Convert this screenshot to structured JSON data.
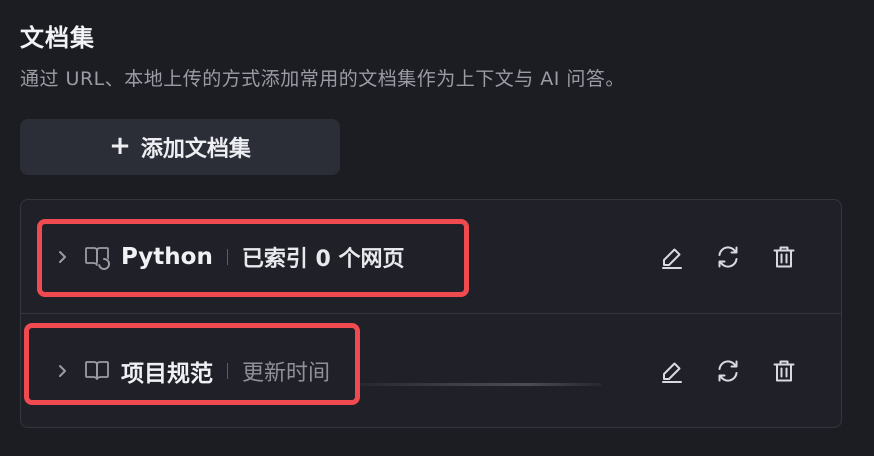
{
  "section": {
    "title": "文档集",
    "description": "通过 URL、本地上传的方式添加常用的文档集作为上下文与 AI 问答。",
    "add_button_label": "添加文档集",
    "add_button_icon": "plus-icon"
  },
  "docsets": [
    {
      "name": "Python",
      "meta": "已索引 0 个网页",
      "status": "indexing"
    },
    {
      "name": "项目规范",
      "meta": "更新时间",
      "status": "loading"
    }
  ],
  "actions": {
    "edit_icon": "pencil-icon",
    "refresh_icon": "refresh-icon",
    "delete_icon": "trash-icon"
  },
  "colors": {
    "background": "#1c1d23",
    "highlight": "#ef4a4f",
    "button_bg": "#2c2e37"
  }
}
